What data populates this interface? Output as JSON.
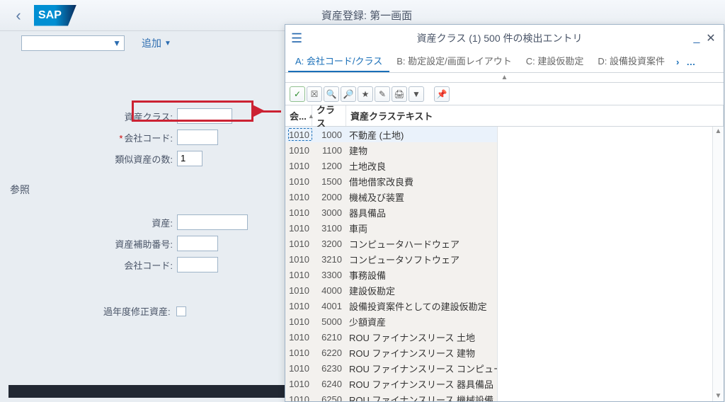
{
  "header": {
    "page_title": "資産登録: 第一画面",
    "logo_text": "SAP"
  },
  "toolbar": {
    "add_label": "追加"
  },
  "form": {
    "asset_class_label": "資産クラス:",
    "company_code_label": "会社コード:",
    "similar_count_label": "類似資産の数:",
    "similar_count_value": "1",
    "reference_title": "参照",
    "ref_asset_label": "資産:",
    "ref_subnumber_label": "資産補助番号:",
    "ref_company_label": "会社コード:",
    "prev_year_label": "過年度修正資産:"
  },
  "popup": {
    "title": "資産クラス (1)  500 件の検出エントリ",
    "tabs": [
      "A: 会社コード/クラス",
      "B: 勘定設定/画面レイアウト",
      "C: 建設仮勘定",
      "D: 設備投資案件"
    ],
    "columns": {
      "c1": "会...",
      "c2": "クラス",
      "c3": "資産クラステキスト"
    },
    "rows": [
      {
        "a": "1010",
        "b": "1000",
        "c": "不動産 (土地)"
      },
      {
        "a": "1010",
        "b": "1100",
        "c": "建物"
      },
      {
        "a": "1010",
        "b": "1200",
        "c": "土地改良"
      },
      {
        "a": "1010",
        "b": "1500",
        "c": "借地借家改良費"
      },
      {
        "a": "1010",
        "b": "2000",
        "c": "機械及び装置"
      },
      {
        "a": "1010",
        "b": "3000",
        "c": "器具備品"
      },
      {
        "a": "1010",
        "b": "3100",
        "c": "車両"
      },
      {
        "a": "1010",
        "b": "3200",
        "c": "コンピュータハードウェア"
      },
      {
        "a": "1010",
        "b": "3210",
        "c": "コンピュータソフトウェア"
      },
      {
        "a": "1010",
        "b": "3300",
        "c": "事務設備"
      },
      {
        "a": "1010",
        "b": "4000",
        "c": "建設仮勘定"
      },
      {
        "a": "1010",
        "b": "4001",
        "c": "設備投資案件としての建設仮勘定"
      },
      {
        "a": "1010",
        "b": "5000",
        "c": "少額資産"
      },
      {
        "a": "1010",
        "b": "6210",
        "c": "ROU ファイナンスリース 土地"
      },
      {
        "a": "1010",
        "b": "6220",
        "c": "ROU ファイナンスリース 建物"
      },
      {
        "a": "1010",
        "b": "6230",
        "c": "ROU ファイナンスリース コンピュータハードウェア"
      },
      {
        "a": "1010",
        "b": "6240",
        "c": "ROU ファイナンスリース 器具備品"
      },
      {
        "a": "1010",
        "b": "6250",
        "c": "ROU ファイナンスリース 機械設備"
      }
    ]
  }
}
